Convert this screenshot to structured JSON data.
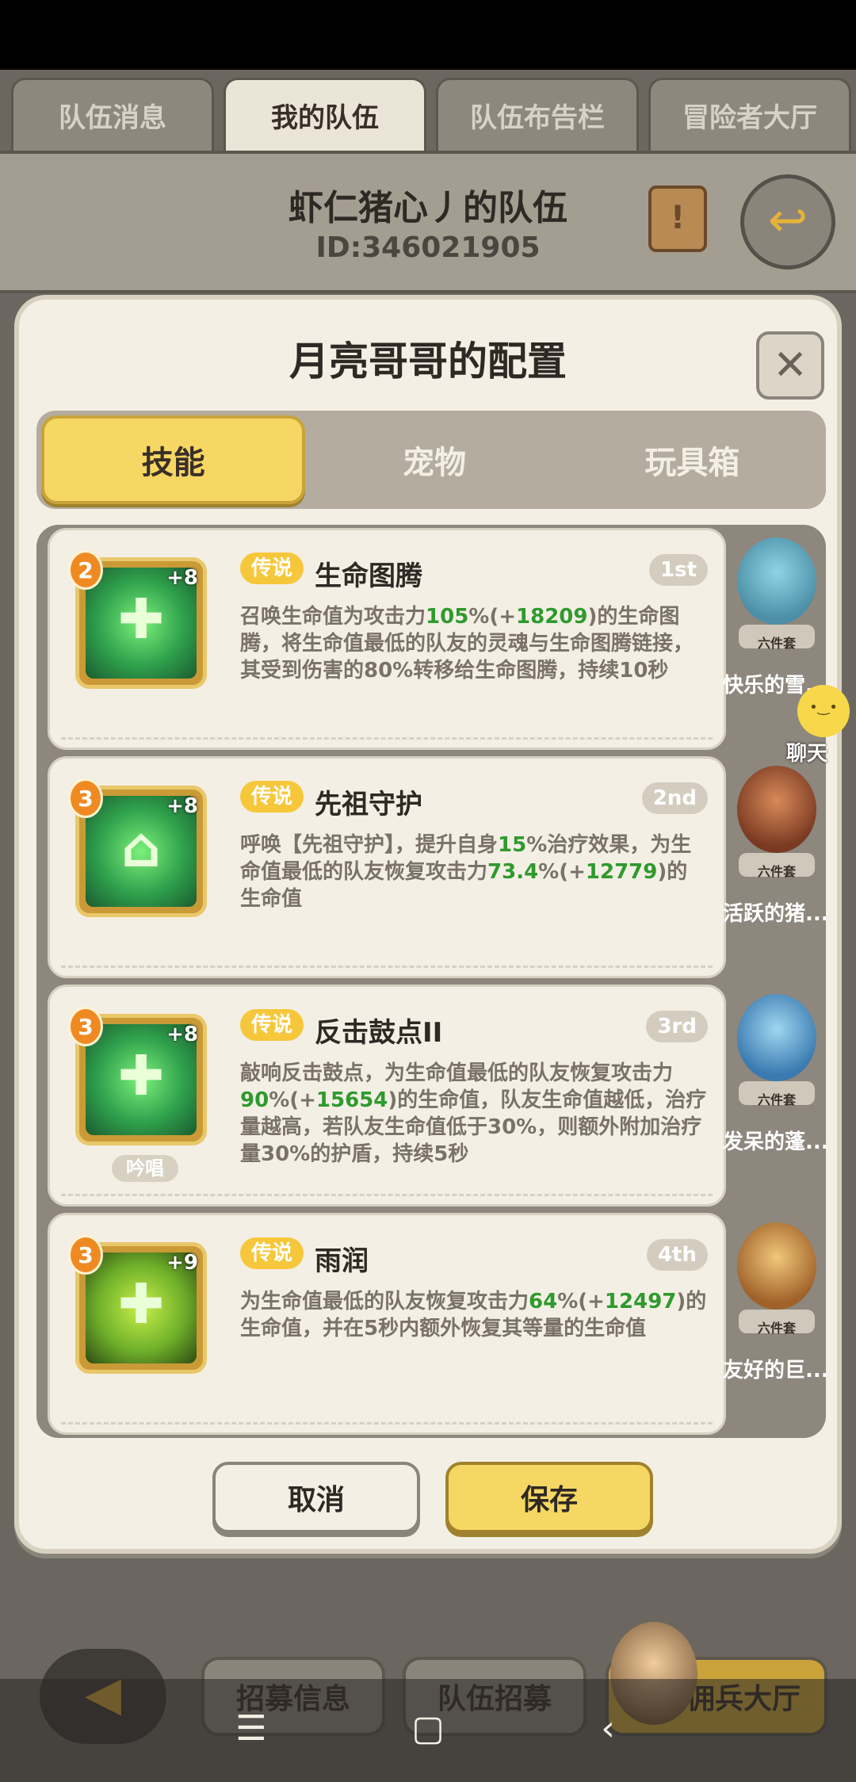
{
  "top_tabs": [
    "队伍消息",
    "我的队伍",
    "队伍布告栏",
    "冒险者大厅"
  ],
  "team": {
    "name": "虾仁猪心丿的队伍",
    "id": "ID:346021905"
  },
  "dialog": {
    "title": "月亮哥哥的配置",
    "sub_tabs": [
      "技能",
      "宠物",
      "玩具箱"
    ]
  },
  "skills": [
    {
      "level": "2",
      "plus": "+8",
      "rarity": "传说",
      "name": "生命图腾",
      "order": "1st",
      "desc_parts": [
        "召唤生命值为攻击力",
        "105",
        "%(+",
        "18209",
        ")的生命图腾，将生命值最低的队友的灵魂与生命图腾链接，其受到伤害的80%转移给生命图腾，持续10秒"
      ]
    },
    {
      "level": "3",
      "plus": "+8",
      "rarity": "传说",
      "name": "先祖守护",
      "order": "2nd",
      "desc_parts": [
        "呼唤【先祖守护】，提升自身",
        "15",
        "%治疗效果，为生命值最低的队友恢复攻击力",
        "73.4",
        "%(+",
        "12779",
        ")的生命值"
      ]
    },
    {
      "level": "3",
      "plus": "+8",
      "rarity": "传说",
      "name": "反击鼓点II",
      "order": "3rd",
      "chant": "吟唱",
      "desc_parts": [
        "敲响反击鼓点，为生命值最低的队友恢复攻击力",
        "90",
        "%(+",
        "15654",
        ")的生命值，队友生命值越低，治疗量越高，若队友生命值低于30%，则额外附加治疗量30%的护盾，持续5秒"
      ]
    },
    {
      "level": "3",
      "plus": "+9",
      "rarity": "传说",
      "name": "雨润",
      "order": "4th",
      "desc_parts": [
        "为生命值最低的队友恢复攻击力",
        "64",
        "%(+",
        "12497",
        ")的生命值，并在5秒内额外恢复其等量的生命值"
      ]
    }
  ],
  "pets": [
    {
      "set": "六件套",
      "name": "快乐的雪..."
    },
    {
      "set": "六件套",
      "name": "活跃的猪..."
    },
    {
      "set": "六件套",
      "name": "发呆的蓬..."
    },
    {
      "set": "六件套",
      "name": "友好的巨..."
    }
  ],
  "buttons": {
    "cancel": "取消",
    "save": "保存"
  },
  "chat": {
    "label": "聊天"
  },
  "bottom": {
    "recruit_info": "招募信息",
    "team_recruit": "队伍招募",
    "mercenary_hall": "佣兵大厅"
  }
}
